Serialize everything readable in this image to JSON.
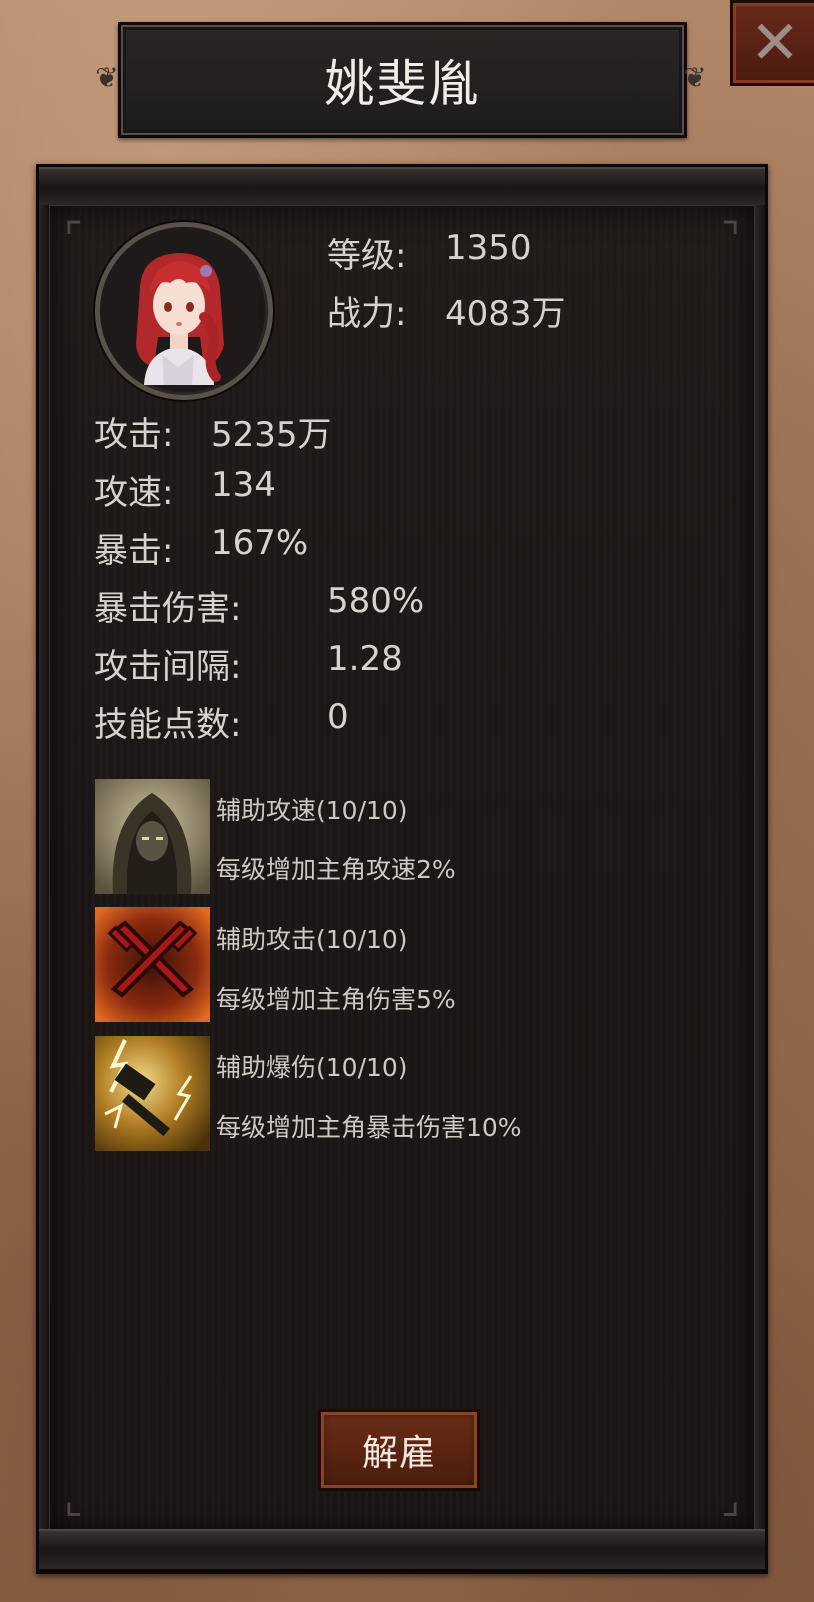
{
  "dialog": {
    "title": "姚斐胤",
    "close_icon": "close-x-icon",
    "dismiss_label": "解雇"
  },
  "hero": {
    "avatar_icon": "red-haired-girl-portrait",
    "level": {
      "label": "等级:",
      "value": "1350"
    },
    "power": {
      "label": "战力:",
      "value": "4083万"
    }
  },
  "stats": [
    {
      "label": "攻击:",
      "value": "5235万"
    },
    {
      "label": "攻速:",
      "value": "134"
    },
    {
      "label": "暴击:",
      "value": "167%"
    },
    {
      "label": "暴击伤害:",
      "value": "580%"
    },
    {
      "label": "攻击间隔:",
      "value": "1.28"
    },
    {
      "label": "技能点数:",
      "value": "0"
    }
  ],
  "skills": [
    {
      "icon": "hooded-figure-icon",
      "name": "辅助攻速(10/10)",
      "desc": "每级增加主角攻速2%"
    },
    {
      "icon": "crossed-swords-icon",
      "name": "辅助攻击(10/10)",
      "desc": "每级增加主角伤害5%"
    },
    {
      "icon": "lightning-hammer-icon",
      "name": "辅助爆伤(10/10)",
      "desc": "每级增加主角暴击伤害10%"
    }
  ],
  "colors": {
    "text": "#d7d2cc",
    "panel_bg": "#1c1716",
    "button_bg": "#5a2412",
    "parchment": "#a47a5a"
  }
}
